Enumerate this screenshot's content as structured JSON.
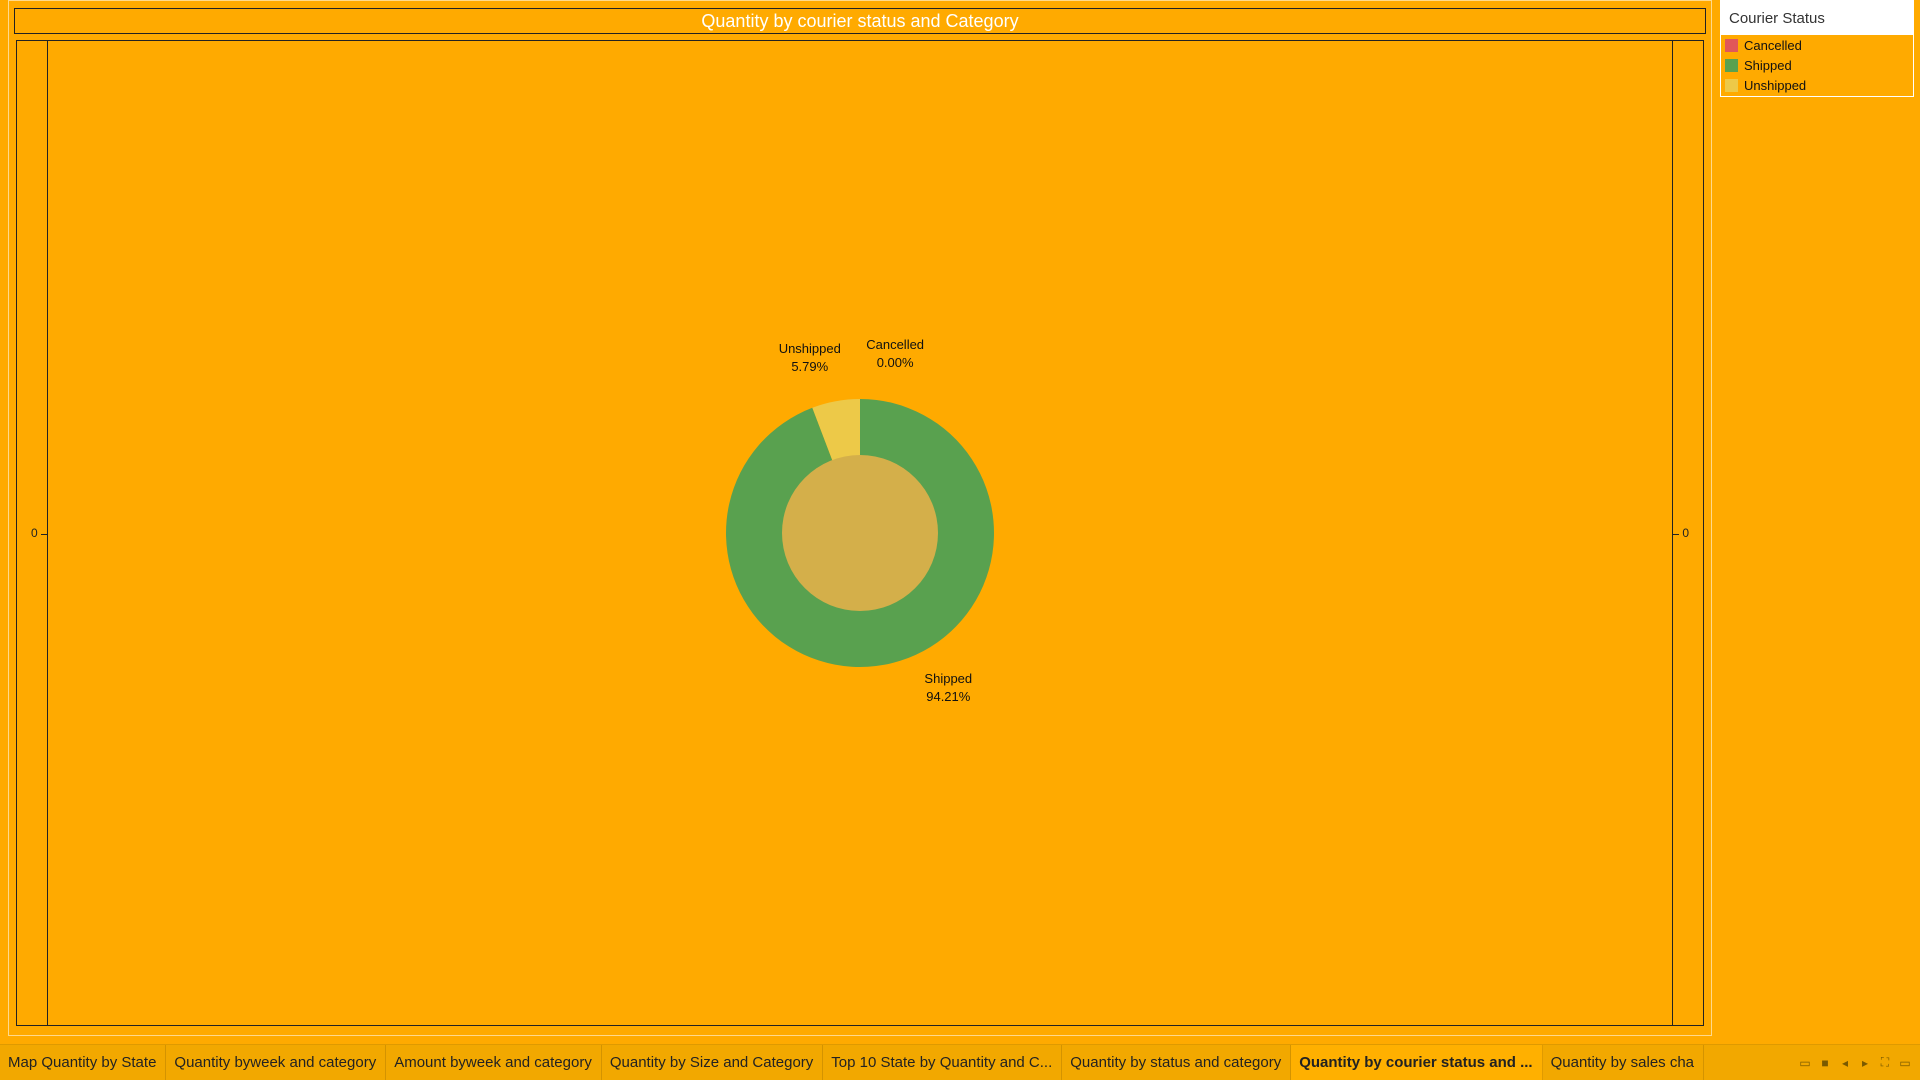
{
  "dashboard": {
    "title": "Quantity by courier status and Category"
  },
  "axes": {
    "left_tick": "0",
    "right_tick": "0"
  },
  "legend": {
    "title": "Courier Status",
    "items": [
      {
        "label": "Cancelled",
        "color": "#E15759"
      },
      {
        "label": "Shipped",
        "color": "#59A14F"
      },
      {
        "label": "Unshipped",
        "color": "#EDC948"
      }
    ]
  },
  "chart_data": {
    "type": "pie",
    "variant": "donut",
    "title": "Quantity by courier status and Category",
    "legend_title": "Courier Status",
    "legend_position": "top-right",
    "hole_color": "#D4AF4A",
    "slices": [
      {
        "label": "Cancelled",
        "percent": 0.0,
        "percent_label": "0.00%",
        "color": "#E15759"
      },
      {
        "label": "Shipped",
        "percent": 94.21,
        "percent_label": "94.21%",
        "color": "#59A14F"
      },
      {
        "label": "Unshipped",
        "percent": 5.79,
        "percent_label": "5.79%",
        "color": "#EDC948"
      }
    ]
  },
  "tabs": [
    {
      "label": "Map Quantity by State",
      "active": false
    },
    {
      "label": "Quantity byweek and category",
      "active": false
    },
    {
      "label": "Amount byweek and category",
      "active": false
    },
    {
      "label": "Quantity by Size and Category",
      "active": false
    },
    {
      "label": "Top 10 State by Quantity and C...",
      "active": false
    },
    {
      "label": "Quantity by status and category",
      "active": false
    },
    {
      "label": "Quantity by courier status and ...",
      "active": true
    },
    {
      "label": "Quantity by sales cha",
      "active": false
    }
  ],
  "tab_controls": [
    {
      "name": "show-sheet-sorter-icon",
      "glyph": "▭"
    },
    {
      "name": "show-filmstrip-icon",
      "glyph": "■"
    },
    {
      "name": "scroll-tabs-left-icon",
      "glyph": "◂"
    },
    {
      "name": "scroll-tabs-right-icon",
      "glyph": "▸"
    },
    {
      "name": "fullscreen-icon",
      "glyph": "⛶"
    },
    {
      "name": "presentation-mode-icon",
      "glyph": "▭"
    }
  ]
}
